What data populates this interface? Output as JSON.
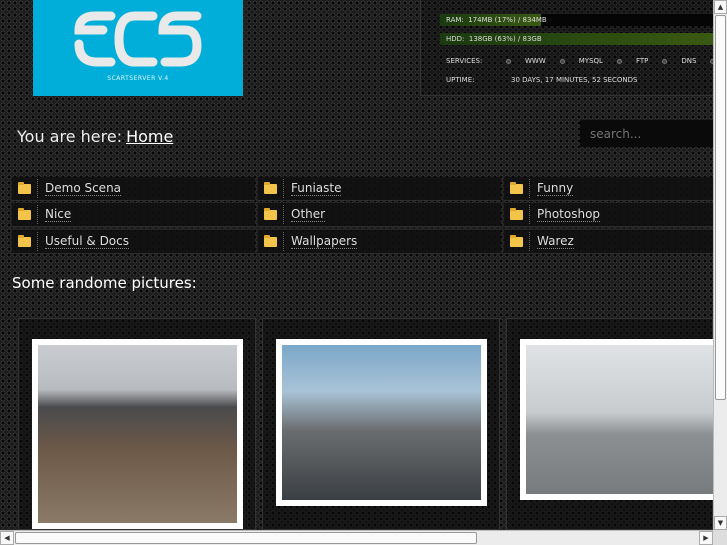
{
  "logo": {
    "text": "SCS",
    "subtitle": "SCARTSERVER V.4"
  },
  "stats": {
    "ram_label": "RAM:",
    "ram_value": "174MB (17%) / 834MB",
    "ram_percent": 17,
    "hdd_label": "HDD:",
    "hdd_value": "138GB (63%) / 83GB",
    "hdd_percent": 63,
    "services_label": "SERVICES:",
    "services": [
      "WWW",
      "MYSQL",
      "FTP",
      "DNS"
    ],
    "uptime_label": "UPTIME:",
    "uptime_value": "30 DAYS, 17 MINUTES, 52 SECONDS"
  },
  "breadcrumb": {
    "prefix": "You are here:",
    "home": "Home"
  },
  "search": {
    "placeholder": "search..."
  },
  "folders": [
    "Demo Scena",
    "Funiaste",
    "Funny",
    "Nice",
    "Other",
    "Photoshop",
    "Useful & Docs",
    "Wallpapers",
    "Warez"
  ],
  "pictures": {
    "heading": "Some randome pictures:"
  }
}
